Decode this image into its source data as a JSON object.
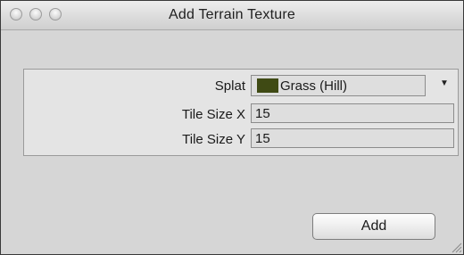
{
  "window": {
    "title": "Add Terrain Texture"
  },
  "form": {
    "splat": {
      "label": "Splat",
      "value": "Grass (Hill)",
      "swatch_color": "#3f4a14",
      "dropdown_icon": "triangle-down-icon"
    },
    "tile_size_x": {
      "label": "Tile Size X",
      "value": "15"
    },
    "tile_size_y": {
      "label": "Tile Size Y",
      "value": "15"
    }
  },
  "actions": {
    "add_label": "Add"
  }
}
